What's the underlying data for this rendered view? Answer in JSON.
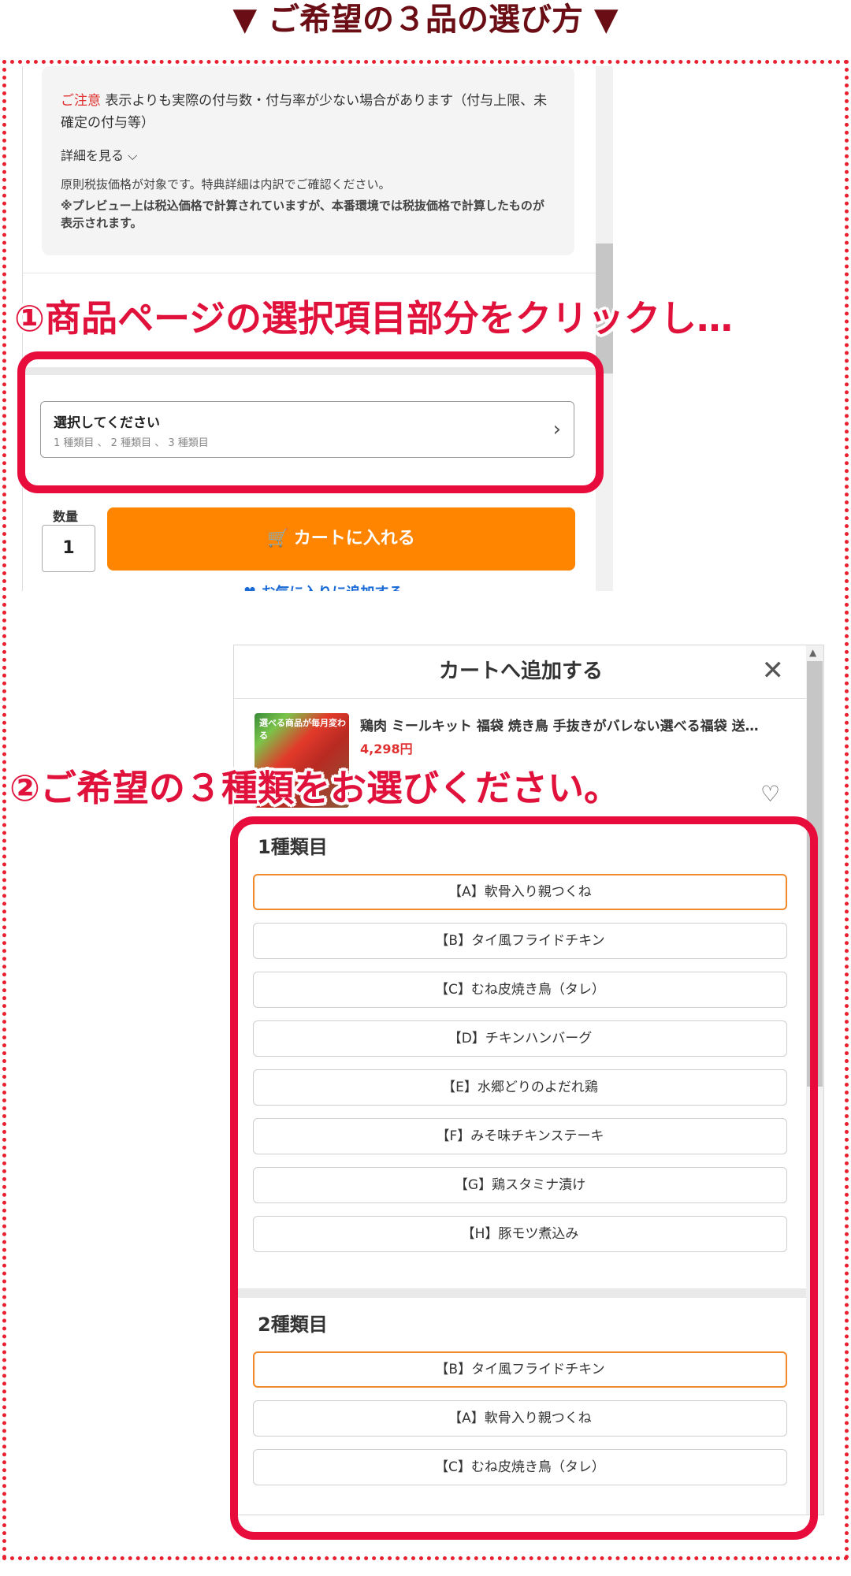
{
  "header": {
    "title": "▼ ご希望の３品の選び方 ▼"
  },
  "step1": {
    "caption": "①商品ページの選択項目部分をクリックし…",
    "notice": {
      "warn_label": "ご注意",
      "text": "表示よりも実際の付与数・付与率が少ない場合があります（付与上限、未確定の付与等）",
      "details_link": "詳細を見る ⌵",
      "note1": "原則税抜価格が対象です。特典詳細は内訳でご確認ください。",
      "note2": "※プレビュー上は税込価格で計算されていますが、本番環境では税抜価格で計算したものが表示されます。"
    },
    "select": {
      "label": "選択してください",
      "sub": "1 種類目 、 2 種類目 、 3 種類目"
    },
    "quantity": {
      "label": "数量",
      "value": "1"
    },
    "cart_button": "カートに入れる",
    "favorite_link": "お気に入りに追加する"
  },
  "step2": {
    "caption": "②ご希望の３種類をお選びください。",
    "modal_title": "カートへ追加する",
    "product": {
      "name": "鶏肉 ミールキット 福袋 焼き鳥 手抜きがバレない選べる福袋 送…",
      "price": "4,298円",
      "thumb_label": "選べる商品が毎月変わる"
    },
    "section1": {
      "title": "1種類目",
      "options": [
        "【A】軟骨入り親つくね",
        "【B】タイ風フライドチキン",
        "【C】むね皮焼き鳥（タレ）",
        "【D】チキンハンバーグ",
        "【E】水郷どりのよだれ鶏",
        "【F】みそ味チキンステーキ",
        "【G】鶏スタミナ漬け",
        "【H】豚モツ煮込み"
      ]
    },
    "section2": {
      "title": "2種類目",
      "options": [
        "【B】タイ風フライドチキン",
        "【A】軟骨入り親つくね",
        "【C】むね皮焼き鳥（タレ）"
      ]
    }
  },
  "colors": {
    "accent_red": "#e80c3d",
    "cart_orange": "#ff8400",
    "title_maroon": "#6b0d14",
    "selected_border": "#f08a2a"
  }
}
